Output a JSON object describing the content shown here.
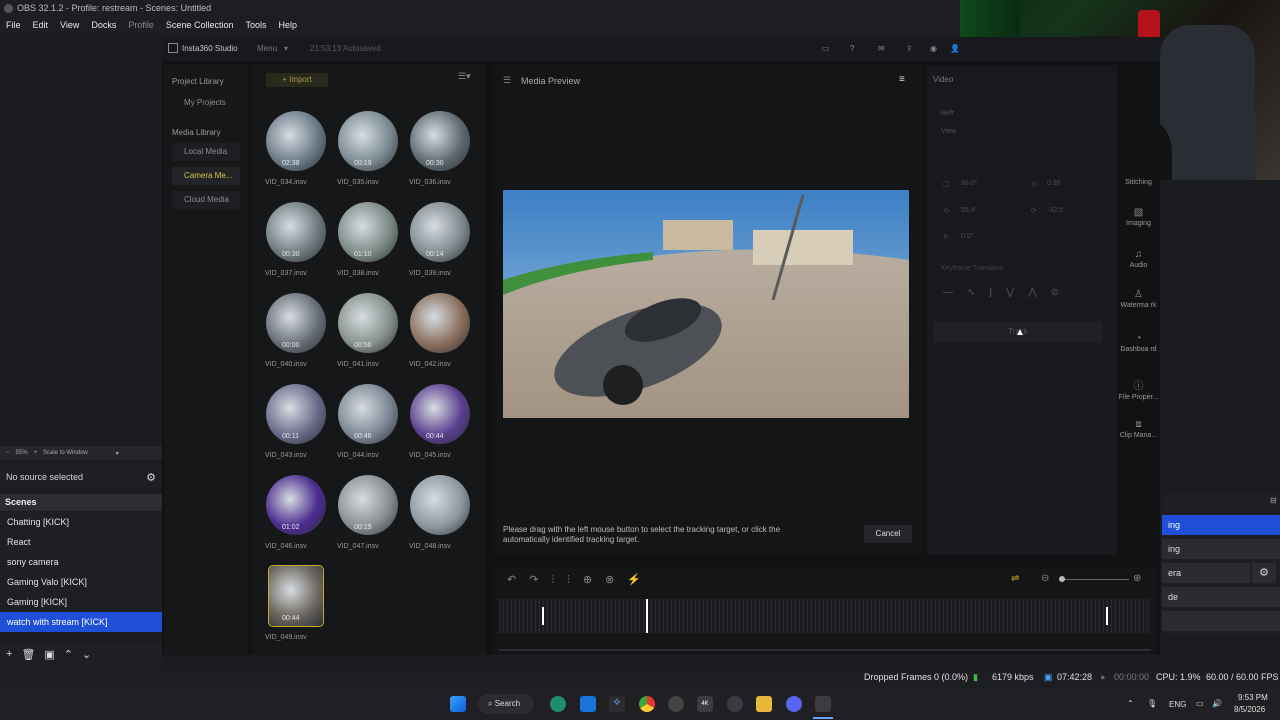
{
  "obs": {
    "title": "OBS 32.1.2 - Profile: restream - Scenes: Untitled",
    "menu": [
      "File",
      "Edit",
      "View",
      "Docks",
      "Profile",
      "Scene Collection",
      "Tools",
      "Help"
    ],
    "zoom": "55%",
    "scale_mode": "Scale to Window",
    "no_source": "No source selected",
    "scenes_header": "Scenes",
    "scenes": [
      "Chatting [KICK]",
      "React",
      "sony camera",
      "Gaming Valo [KICK]",
      "Gaming [KICK]",
      "watch with stream [KICK]"
    ],
    "right_transitions": [
      "ing",
      "ing",
      "era",
      "de"
    ],
    "status": {
      "dropped": "Dropped Frames 0 (0.0%)",
      "bitrate": "6179 kbps",
      "stream_time": "07:42:28",
      "rec_time": "00:00:00",
      "cpu": "CPU: 1.9%",
      "fps": "60.00 / 60.00 FPS"
    }
  },
  "insta": {
    "app_title": "Insta360 Studio",
    "menu_label": "Menu",
    "autosave": "21:53:13 Autosaved",
    "project_library": "Project Library",
    "my_projects": "My Projects",
    "media_library": "Media Library",
    "local_media": "Local Media",
    "camera_media": "Camera Me...",
    "cloud_media": "Cloud Media",
    "import_label": "+ Import",
    "preview_title": "Media Preview",
    "hint": "Please drag with the left mouse button to select the tracking target, or click the automatically identified tracking target.",
    "cancel": "Cancel",
    "video_tab": "Video",
    "refr": "Refr",
    "view": "View",
    "fov_value": "88.0°",
    "distance_value": "0.95",
    "pitch_value": "55.4°",
    "yaw_value": "-32.5°",
    "roll_value": "0.0°",
    "keyframe_transition": "Keyframe Transition",
    "track_btn": "Track",
    "side_tabs": [
      "Stitching",
      "Imaging",
      "Audio",
      "Waterma rk",
      "Dashboa rd",
      "File Proper...",
      "Clip Mana..."
    ],
    "thumbs": [
      {
        "name": "VID_034.insv",
        "time": "02:38"
      },
      {
        "name": "VID_035.insv",
        "time": "00:19"
      },
      {
        "name": "VID_036.insv",
        "time": "00:30"
      },
      {
        "name": "VID_037.insv",
        "time": "00:30"
      },
      {
        "name": "VID_038.insv",
        "time": "01:10"
      },
      {
        "name": "VID_039.insv",
        "time": "00:14"
      },
      {
        "name": "VID_040.insv",
        "time": "00:00"
      },
      {
        "name": "VID_041.insv",
        "time": "00:56"
      },
      {
        "name": "VID_042.insv",
        "time": ""
      },
      {
        "name": "VID_043.insv",
        "time": "00:11"
      },
      {
        "name": "VID_044.insv",
        "time": "00:46"
      },
      {
        "name": "VID_045.insv",
        "time": "00:44"
      },
      {
        "name": "VID_046.insv",
        "time": "01:02"
      },
      {
        "name": "VID_047.insv",
        "time": "00:19"
      },
      {
        "name": "VID_048.insv",
        "time": ""
      },
      {
        "name": "VID_049.insv",
        "time": "00:44"
      }
    ]
  },
  "taskbar": {
    "search": "Search",
    "lang": "ENG",
    "time": "9:53 PM",
    "date": "8/5/2026"
  }
}
